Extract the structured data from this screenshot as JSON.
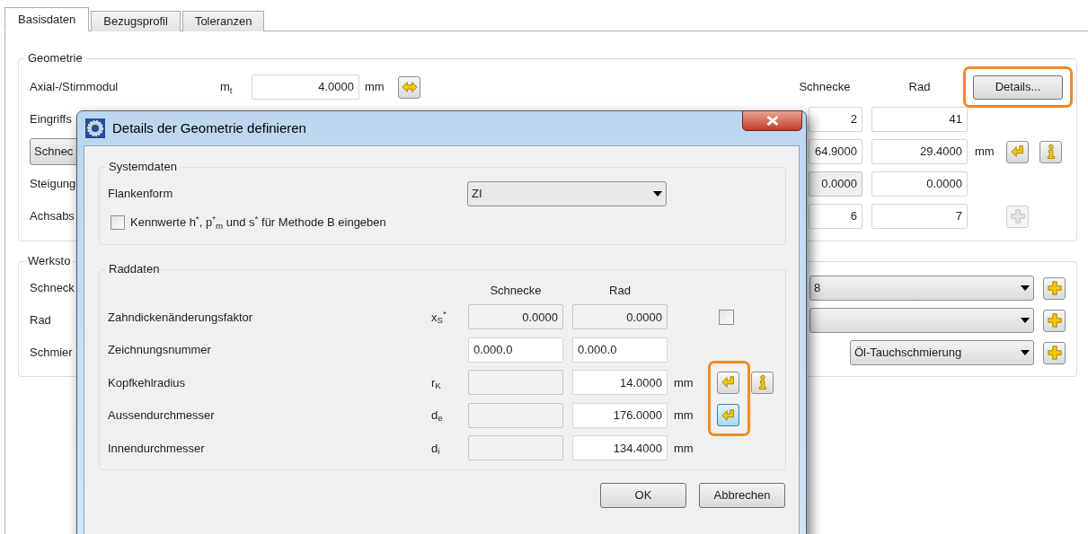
{
  "tabs": [
    {
      "label": "Basisdaten",
      "selected": true
    },
    {
      "label": "Bezugsprofil",
      "selected": false
    },
    {
      "label": "Toleranzen",
      "selected": false
    }
  ],
  "geometrie": {
    "title": "Geometrie",
    "headers": [
      "Schnecke",
      "Rad"
    ],
    "details_button": {
      "label": "Details...",
      "highlighted": true
    },
    "rows": [
      {
        "kind": "module",
        "label": "Axial-/Stirnmodul",
        "symbol": "m$_{t}$",
        "value": "4.0000",
        "unit": "mm",
        "buttons": [
          {
            "kind": "swap",
            "disabled": false
          }
        ]
      },
      {
        "kind": "pair",
        "label": "Eingriffs",
        "schnecke": "2",
        "rad": "41"
      },
      {
        "kind": "pair",
        "label": "Schnec",
        "label_button": true,
        "schnecke": "64.9000",
        "rad": "29.4000",
        "unit": "mm",
        "buttons": [
          {
            "kind": "apply",
            "disabled": false
          },
          {
            "kind": "info",
            "disabled": false
          }
        ]
      },
      {
        "kind": "pair",
        "label": "Steigung",
        "schnecke": "0.0000",
        "schnecke_disabled": true,
        "rad": "0.0000"
      },
      {
        "kind": "pair",
        "label": "Achsabs",
        "schnecke": "6",
        "rad": "7",
        "buttons": [
          {
            "kind": "add",
            "disabled": true
          }
        ]
      }
    ]
  },
  "werkstoff": {
    "title": "Werksto",
    "rows": [
      {
        "label": "Schneck",
        "kind": "wide",
        "value": "8"
      },
      {
        "label": "Rad",
        "kind": "wide"
      },
      {
        "label": "Schmier",
        "kind": "short",
        "value": "Öl-Tauchschmierung"
      }
    ]
  },
  "dialog": {
    "title": "Details der Geometrie definieren",
    "systemdaten": {
      "title": "Systemdaten",
      "flankenform": {
        "label": "Flankenform",
        "value": "ZI"
      },
      "checkbox": {
        "label": "Kennwerte h$^{*}$, p$^{*}$$_{m}$ und s$^{*}$ für Methode B eingeben",
        "checked": false
      }
    },
    "raddaten": {
      "title": "Raddaten",
      "headers": [
        "Schnecke",
        "Rad"
      ],
      "callout": true,
      "rows": [
        {
          "label": "Zahndickenänderungsfaktor",
          "symbol": "x$_{S}$$^{*}$",
          "schnecke": "0.0000",
          "schnecke_disabled": true,
          "rad": "0.0000",
          "rad_disabled": true,
          "checkbox": {
            "checked": false
          }
        },
        {
          "label": "Zeichnungsnummer",
          "left_aligned": true,
          "schnecke": "0.000.0",
          "rad": "0.000.0"
        },
        {
          "label": "Kopfkehlradius",
          "symbol": "r$_{K}$",
          "schnecke_disabled": true,
          "rad": "14.0000",
          "unit": "mm",
          "buttons": [
            {
              "kind": "apply",
              "focused": false
            },
            {
              "kind": "info",
              "focused": false
            }
          ]
        },
        {
          "label": "Aussendurchmesser",
          "symbol": "d$_{e}$",
          "schnecke_disabled": true,
          "rad": "176.0000",
          "unit": "mm",
          "buttons": [
            {
              "kind": "apply",
              "focused": true
            }
          ]
        },
        {
          "label": "Innendurchmesser",
          "symbol": "d$_{i}$",
          "schnecke_disabled": true,
          "rad": "134.4000",
          "unit": "mm"
        }
      ]
    },
    "buttons": [
      "OK",
      "Abbrechen"
    ]
  }
}
